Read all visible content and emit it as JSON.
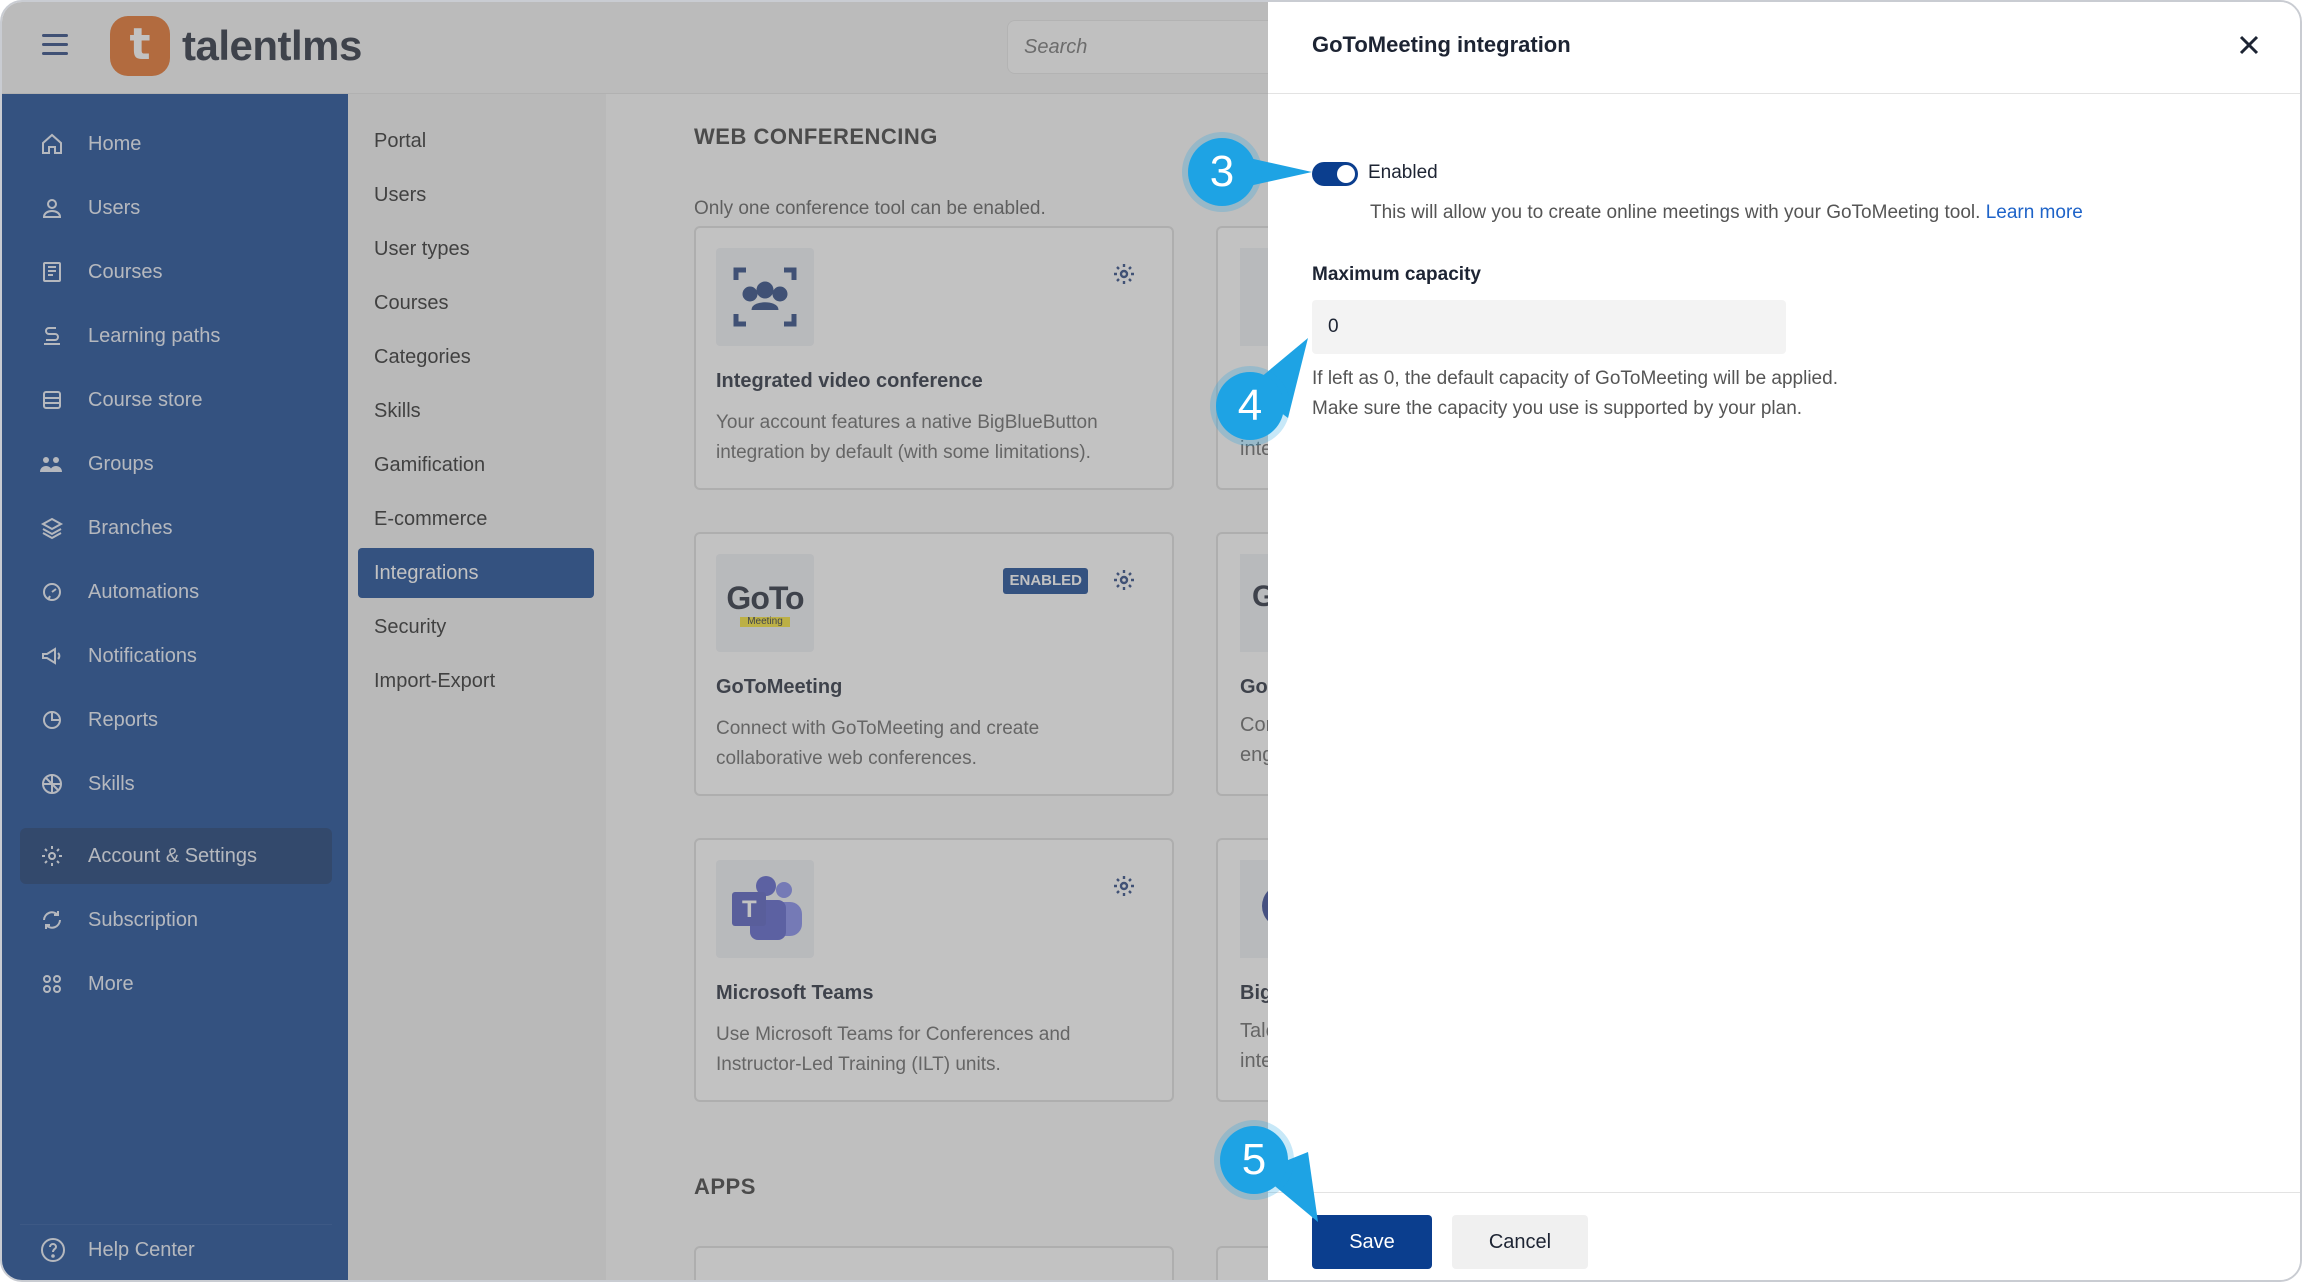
{
  "app": {
    "logo_letter": "t",
    "name": "talentlms",
    "search_placeholder": "Search"
  },
  "sidebar": {
    "items": [
      {
        "label": "Home",
        "icon": "home-icon"
      },
      {
        "label": "Users",
        "icon": "user-icon"
      },
      {
        "label": "Courses",
        "icon": "book-icon"
      },
      {
        "label": "Learning paths",
        "icon": "path-icon"
      },
      {
        "label": "Course store",
        "icon": "store-icon"
      },
      {
        "label": "Groups",
        "icon": "groups-icon"
      },
      {
        "label": "Branches",
        "icon": "layers-icon"
      },
      {
        "label": "Automations",
        "icon": "automation-icon"
      },
      {
        "label": "Notifications",
        "icon": "megaphone-icon"
      },
      {
        "label": "Reports",
        "icon": "pie-chart-icon"
      },
      {
        "label": "Skills",
        "icon": "skills-icon"
      },
      {
        "label": "Account & Settings",
        "icon": "gear-icon"
      },
      {
        "label": "Subscription",
        "icon": "subscription-icon"
      },
      {
        "label": "More",
        "icon": "grid-dots-icon"
      }
    ],
    "active_index": 11,
    "help_label": "Help Center"
  },
  "subnav": {
    "items": [
      "Portal",
      "Users",
      "User types",
      "Courses",
      "Categories",
      "Skills",
      "Gamification",
      "E-commerce",
      "Integrations",
      "Security",
      "Import-Export"
    ],
    "active_index": 8
  },
  "main": {
    "section_title": "WEB CONFERENCING",
    "section_note": "Only one conference tool can be enabled.",
    "cards": [
      {
        "name": "Integrated video conference",
        "desc": "Your account features a native BigBlueButton integration by default (with some limitations).",
        "enabled": false
      },
      {
        "name": "GoToMeeting",
        "desc": "Connect with GoToMeeting and create collaborative web conferences.",
        "enabled": true,
        "badge": "ENABLED",
        "logo_text": "GoTo",
        "logo_sub": "Meeting"
      },
      {
        "name": "Microsoft Teams",
        "desc": "Use Microsoft Teams for Conferences and Instructor-Led Training (ILT) units.",
        "enabled": false,
        "logo_text": "T"
      }
    ],
    "stubs": [
      {
        "lines": [
          "inte"
        ]
      },
      {
        "title": "Go",
        "lines": [
          "Cor",
          "eng"
        ],
        "logo_text": "G"
      },
      {
        "title": "Big",
        "lines": [
          "Tale",
          "inte"
        ]
      }
    ],
    "apps_title": "APPS"
  },
  "drawer": {
    "title": "GoToMeeting integration",
    "toggle_label": "Enabled",
    "toggle_on": true,
    "toggle_help": "This will allow you to create online meetings with your GoToMeeting tool.",
    "learn_more": "Learn more",
    "capacity_label": "Maximum capacity",
    "capacity_value": "0",
    "capacity_help_1": "If left as 0, the default capacity of GoToMeeting will be applied.",
    "capacity_help_2": "Make sure the capacity you use is supported by your plan.",
    "save_label": "Save",
    "cancel_label": "Cancel"
  },
  "callouts": [
    "3",
    "4",
    "5"
  ],
  "colors": {
    "sidebar_bg": "#0b3e8e",
    "accent": "#0b3e8e",
    "callout": "#1ea3e4",
    "logo": "#e46a1e",
    "link": "#1e63c8"
  }
}
